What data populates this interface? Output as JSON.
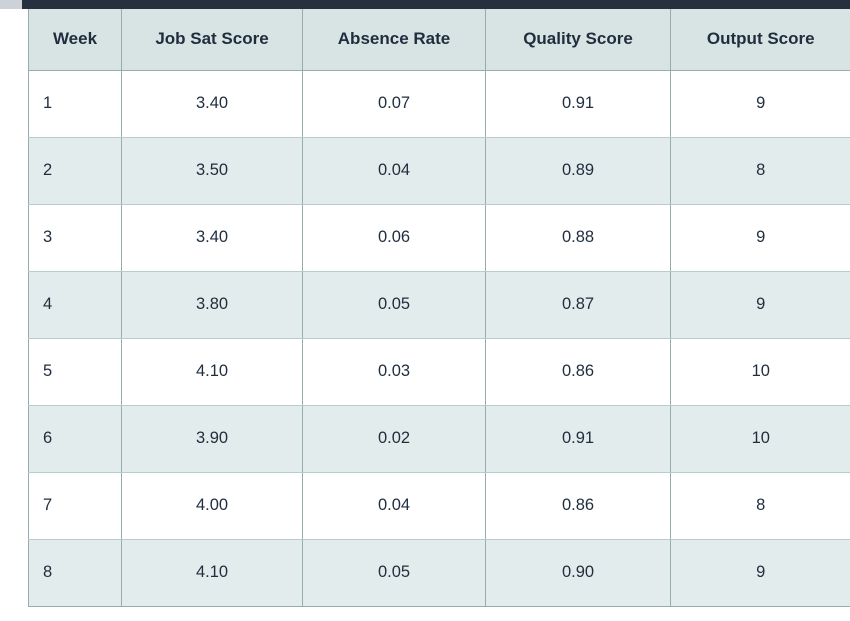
{
  "window": {
    "top_bar_color": "#26303f",
    "corner_block_color": "#ccd2d8"
  },
  "table": {
    "header_background": "#d8e4e4",
    "header_text_color": "#1f2d3d",
    "row_alt_background": "#e3ecec",
    "border_color": "#97adad",
    "columns": [
      {
        "key": "week",
        "label": "Week",
        "align": "left"
      },
      {
        "key": "jobsat",
        "label": "Job Sat Score",
        "align": "center"
      },
      {
        "key": "absence",
        "label": "Absence Rate",
        "align": "center"
      },
      {
        "key": "quality",
        "label": "Quality Score",
        "align": "center"
      },
      {
        "key": "output",
        "label": "Output Score",
        "align": "center"
      }
    ],
    "rows": [
      {
        "week": "1",
        "jobsat": "3.40",
        "absence": "0.07",
        "quality": "0.91",
        "output": "9"
      },
      {
        "week": "2",
        "jobsat": "3.50",
        "absence": "0.04",
        "quality": "0.89",
        "output": "8"
      },
      {
        "week": "3",
        "jobsat": "3.40",
        "absence": "0.06",
        "quality": "0.88",
        "output": "9"
      },
      {
        "week": "4",
        "jobsat": "3.80",
        "absence": "0.05",
        "quality": "0.87",
        "output": "9"
      },
      {
        "week": "5",
        "jobsat": "4.10",
        "absence": "0.03",
        "quality": "0.86",
        "output": "10"
      },
      {
        "week": "6",
        "jobsat": "3.90",
        "absence": "0.02",
        "quality": "0.91",
        "output": "10"
      },
      {
        "week": "7",
        "jobsat": "4.00",
        "absence": "0.04",
        "quality": "0.86",
        "output": "8"
      },
      {
        "week": "8",
        "jobsat": "4.10",
        "absence": "0.05",
        "quality": "0.90",
        "output": "9"
      }
    ]
  },
  "chart_data": {
    "type": "table",
    "title": "",
    "columns": [
      "Week",
      "Job Sat Score",
      "Absence Rate",
      "Quality Score",
      "Output Score"
    ],
    "index": [
      1,
      2,
      3,
      4,
      5,
      6,
      7,
      8
    ],
    "series": [
      {
        "name": "Job Sat Score",
        "values": [
          3.4,
          3.5,
          3.4,
          3.8,
          4.1,
          3.9,
          4.0,
          4.1
        ]
      },
      {
        "name": "Absence Rate",
        "values": [
          0.07,
          0.04,
          0.06,
          0.05,
          0.03,
          0.02,
          0.04,
          0.05
        ]
      },
      {
        "name": "Quality Score",
        "values": [
          0.91,
          0.89,
          0.88,
          0.87,
          0.86,
          0.91,
          0.86,
          0.9
        ]
      },
      {
        "name": "Output Score",
        "values": [
          9,
          8,
          9,
          9,
          10,
          10,
          8,
          9
        ]
      }
    ]
  }
}
